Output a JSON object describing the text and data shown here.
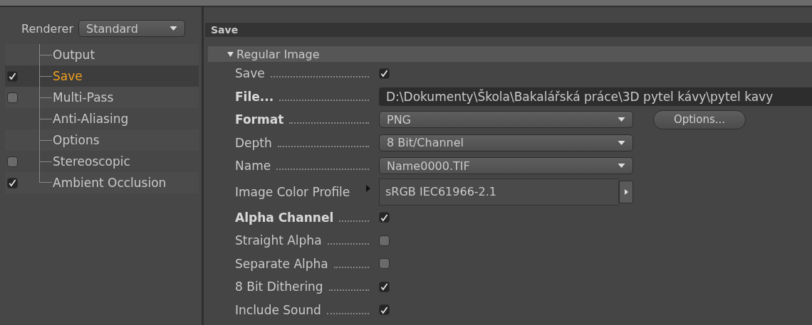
{
  "renderer": {
    "label": "Renderer",
    "value": "Standard"
  },
  "tree": [
    {
      "label": "Output",
      "selected": false
    },
    {
      "label": "Save",
      "selected": true,
      "checked": true
    },
    {
      "label": "Multi-Pass",
      "selected": false,
      "checked": false
    },
    {
      "label": "Anti-Aliasing",
      "selected": false
    },
    {
      "label": "Options",
      "selected": false
    },
    {
      "label": "Stereoscopic",
      "selected": false,
      "checked": false
    },
    {
      "label": "Ambient Occlusion",
      "selected": false,
      "checked": true
    }
  ],
  "panel": {
    "title": "Save",
    "group": {
      "title": "Regular Image",
      "expanded": true
    }
  },
  "rows": [
    {
      "kind": "checkbox",
      "label": "Save",
      "bold": false,
      "checked": true
    },
    {
      "kind": "path",
      "label": "File...",
      "bold": true,
      "value": "D:\\Dokumenty\\Škola\\Bakalářská práce\\3D pytel kávy\\pytel kavy"
    },
    {
      "kind": "dropdown",
      "label": "Format",
      "bold": true,
      "value": "PNG",
      "button": "Options..."
    },
    {
      "kind": "dropdown",
      "label": "Depth",
      "bold": false,
      "value": "8 Bit/Channel"
    },
    {
      "kind": "dropdown",
      "label": "Name",
      "bold": false,
      "value": "Name0000.TIF"
    },
    {
      "kind": "profile",
      "label": "Image Color Profile",
      "bold": false,
      "value": "sRGB IEC61966-2.1"
    },
    {
      "kind": "checkbox",
      "label": "Alpha Channel",
      "bold": true,
      "checked": true
    },
    {
      "kind": "checkbox",
      "label": "Straight Alpha",
      "bold": false,
      "checked": false
    },
    {
      "kind": "checkbox",
      "label": "Separate Alpha",
      "bold": false,
      "checked": false
    },
    {
      "kind": "checkbox",
      "label": "8 Bit Dithering",
      "bold": false,
      "checked": true
    },
    {
      "kind": "checkbox",
      "label": "Include Sound",
      "bold": false,
      "checked": true
    }
  ]
}
